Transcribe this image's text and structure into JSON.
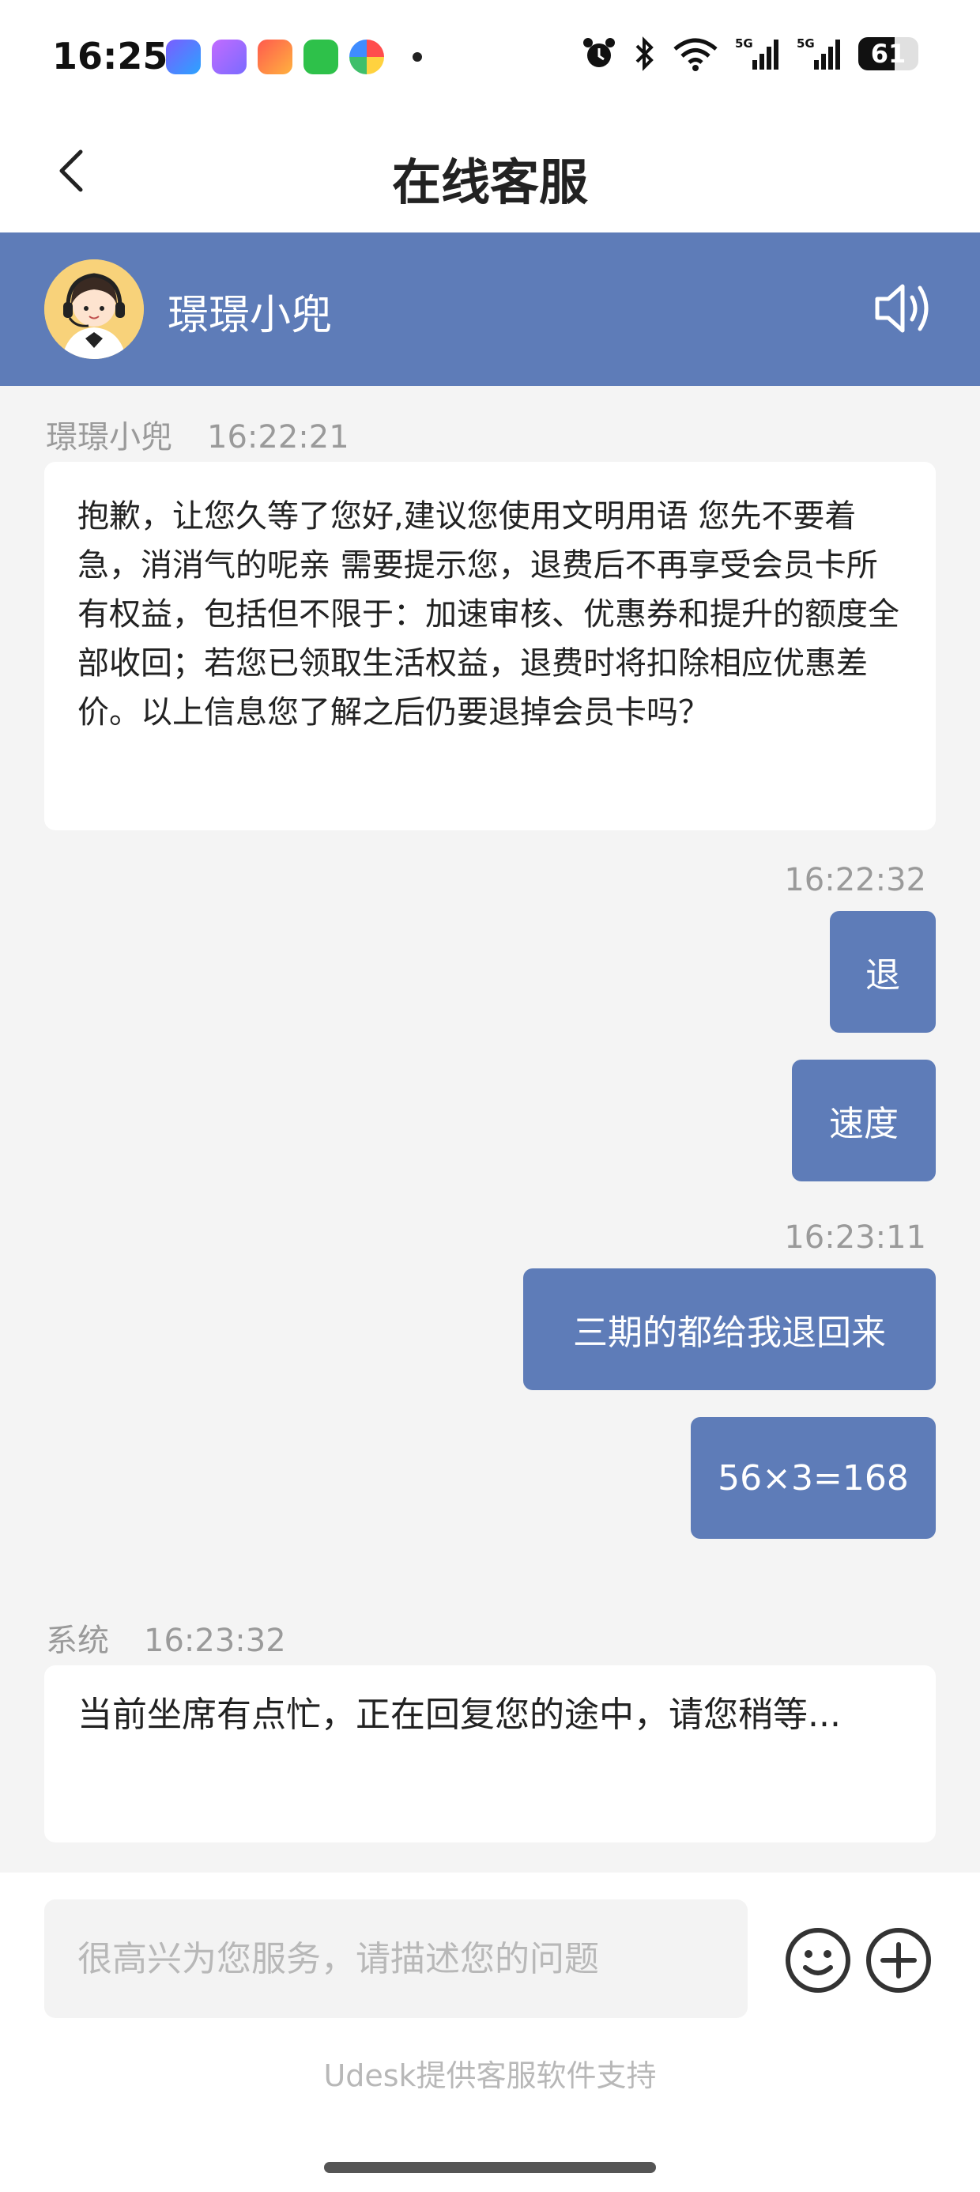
{
  "status_bar": {
    "time": "16:25",
    "battery": "61",
    "battery_level": 0.61,
    "app_icons": [
      "camera-app-icon",
      "cat-app-icon",
      "clown-app-icon",
      "wechat-icon",
      "pinwheel-app-icon"
    ],
    "network": [
      "5G",
      "5G"
    ]
  },
  "nav": {
    "title": "在线客服",
    "back_icon": "chevron-left-icon"
  },
  "agent": {
    "name": "璟璟小兜",
    "avatar_icon": "customer-service-avatar-icon",
    "speaker_icon": "speaker-icon"
  },
  "messages": [
    {
      "sender": "璟璟小兜",
      "time": "16:22:21",
      "text": "抱歉，让您久等了您好,建议您使用文明用语 您先不要着急，消消气的呢亲 需要提示您，退费后不再享受会员卡所有权益，包括但不限于：加速审核、优惠券和提升的额度全部收回；若您已领取生活权益，退费时将扣除相应优惠差价。以上信息您了解之后仍要退掉会员卡吗？"
    },
    {
      "time": "16:22:32"
    },
    {
      "text": "退"
    },
    {
      "text": "速度"
    },
    {
      "time": "16:23:11"
    },
    {
      "text": "三期的都给我退回来"
    },
    {
      "text": "56×3=168"
    },
    {
      "sender": "系统",
      "time": "16:23:32",
      "text": "当前坐席有点忙，正在回复您的途中，请您稍等..."
    }
  ],
  "input": {
    "placeholder": "很高兴为您服务，请描述您的问题",
    "value": "",
    "emoji_icon": "emoji-icon",
    "plus_icon": "plus-circle-icon"
  },
  "footer": {
    "powered_by": "Udesk提供客服软件支持"
  },
  "colors": {
    "brand": "#5e7cb8",
    "background": "#f4f4f4",
    "meta_text": "#9a9a9a"
  }
}
